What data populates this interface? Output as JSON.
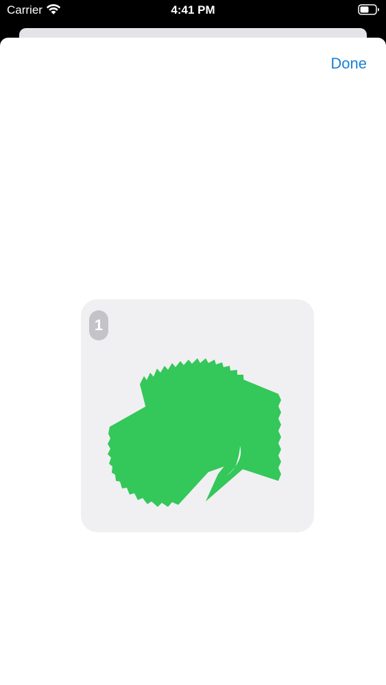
{
  "status_bar": {
    "carrier": "Carrier",
    "time": "4:41 PM",
    "icons": [
      "wifi-icon",
      "battery-icon"
    ]
  },
  "sheet": {
    "done_label": "Done",
    "accent_color": "#1a7fd6"
  },
  "sticker": {
    "count": "1",
    "fill_color": "#34c759",
    "card_color": "#f0f0f2"
  }
}
